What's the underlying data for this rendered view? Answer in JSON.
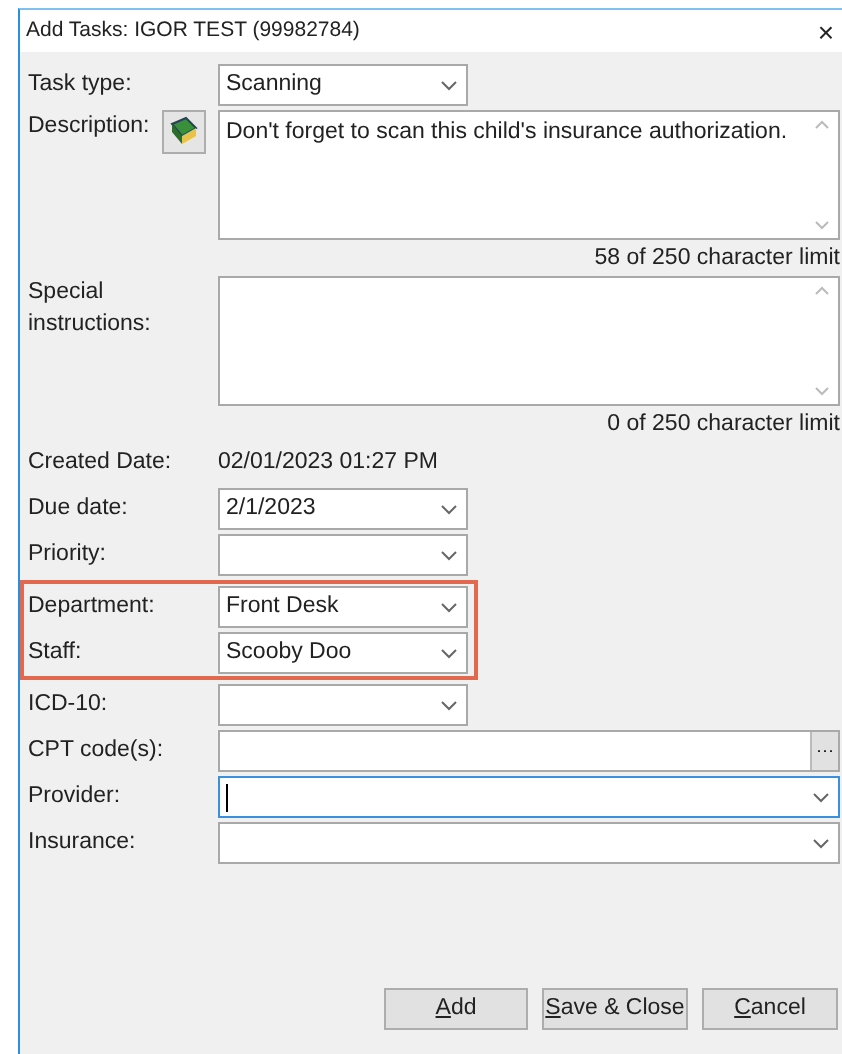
{
  "window": {
    "title": "Add Tasks: IGOR TEST (99982784)",
    "close": "×"
  },
  "fields": [
    {
      "kind": "select",
      "label": "Task type:",
      "value": "Scanning"
    },
    {
      "kind": "textarea",
      "label": "Description:",
      "value": "Don't forget to scan this child's insurance authorization.",
      "has_icon": true,
      "counter": "58 of 250 character limit"
    },
    {
      "kind": "textarea",
      "label": "Special instructions:",
      "has_icon": false,
      "counter": "0 of 250 character limit"
    },
    {
      "kind": "static",
      "label": "Created Date:",
      "value": "02/01/2023 01:27 PM"
    },
    {
      "kind": "select",
      "label": "Due date:",
      "value": "2/1/2023"
    },
    {
      "kind": "select",
      "label": "Priority:"
    },
    {
      "kind": "select",
      "label": "Department:",
      "value": "Front Desk",
      "highlighted": true
    },
    {
      "kind": "select",
      "label": "Staff:",
      "value": "Scooby Doo",
      "highlighted": true
    },
    {
      "kind": "select",
      "label": "ICD-10:"
    },
    {
      "kind": "ellipsis",
      "label": "CPT code(s):",
      "button": "···"
    },
    {
      "kind": "combo",
      "label": "Provider:",
      "focused": true
    },
    {
      "kind": "combo",
      "label": "Insurance:",
      "focused": false
    }
  ],
  "buttons": [
    {
      "label": "Add",
      "mnemonic": true
    },
    {
      "label": "Save & Close",
      "mnemonic": true
    },
    {
      "label": "Cancel",
      "mnemonic": true
    }
  ]
}
